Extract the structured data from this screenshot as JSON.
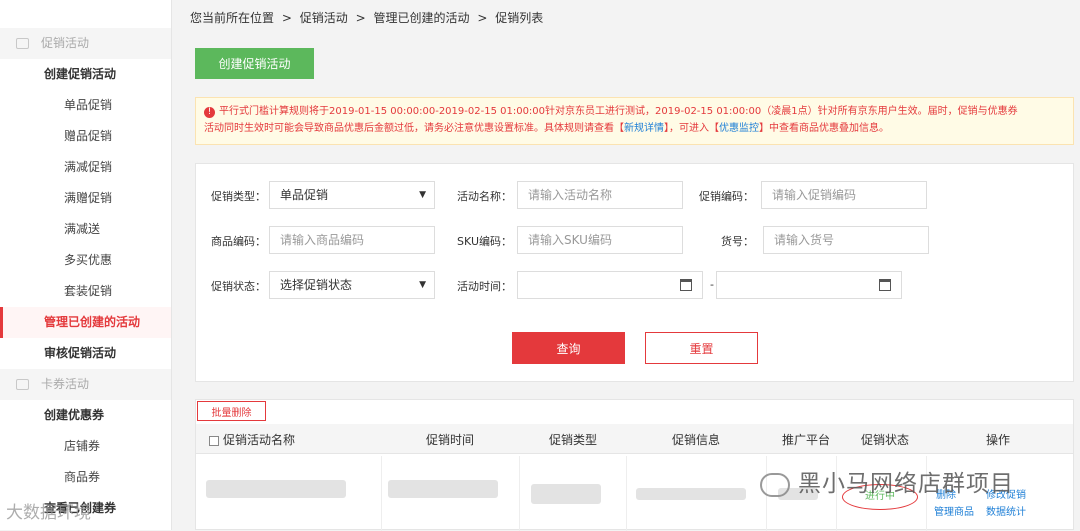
{
  "sidebar": {
    "group1": "促销活动",
    "group1_sub1": "创建促销活动",
    "items": [
      "单品促销",
      "赠品促销",
      "满减促销",
      "满赠促销",
      "满减送",
      "多买优惠",
      "套装促销"
    ],
    "manage": "管理已创建的活动",
    "review": "审核促销活动",
    "group2": "卡券活动",
    "group2_sub1": "创建优惠券",
    "coupon_items": [
      "店铺券",
      "商品券"
    ],
    "group2_sub2": "查看已创建券"
  },
  "breadcrumb": [
    "您当前所在位置",
    ">",
    "促销活动",
    ">",
    "管理已创建的活动",
    ">",
    "促销列表"
  ],
  "create_button": "创建促销活动",
  "notice": {
    "line1": "平行式门槛计算规则将于2019-01-15 00:00:00-2019-02-15 01:00:00针对京东员工进行测试，2019-02-15 01:00:00（凌晨1点）针对所有京东用户生效。届时，促销与优惠券",
    "line2a": "活动同时生效时可能会导致商品优惠后金额过低，请务必注意优惠设置标准。具体规则请查看【",
    "link1": "新规详情",
    "line2b": "】，可进入【",
    "link2": "优惠监控",
    "line2c": "】中查看商品优惠叠加信息。"
  },
  "filter": {
    "promo_type_label": "促销类型：",
    "promo_type_value": "单品促销",
    "activity_name_label": "活动名称：",
    "activity_name_placeholder": "请输入活动名称",
    "promo_code_label": "促销编码：",
    "promo_code_placeholder": "请输入促销编码",
    "product_code_label": "商品编码：",
    "product_code_placeholder": "请输入商品编码",
    "sku_label": "SKU编码：",
    "sku_placeholder": "请输入SKU编码",
    "item_no_label": "货号：",
    "item_no_placeholder": "请输入货号",
    "status_label": "促销状态：",
    "status_value": "选择促销状态",
    "time_label": "活动时间：",
    "time_sep": "-",
    "query": "查询",
    "reset": "重置"
  },
  "table": {
    "batch_delete": "批量删除",
    "headers": [
      "促销活动名称",
      "促销时间",
      "促销类型",
      "促销信息",
      "推广平台",
      "促销状态",
      "操作"
    ],
    "row_status": "进行中",
    "row_ops": [
      "删除",
      "修改促销",
      "管理商品",
      "数据统计"
    ]
  },
  "watermark": "黑小马网络店群项目",
  "watermark2": "大数据环境"
}
